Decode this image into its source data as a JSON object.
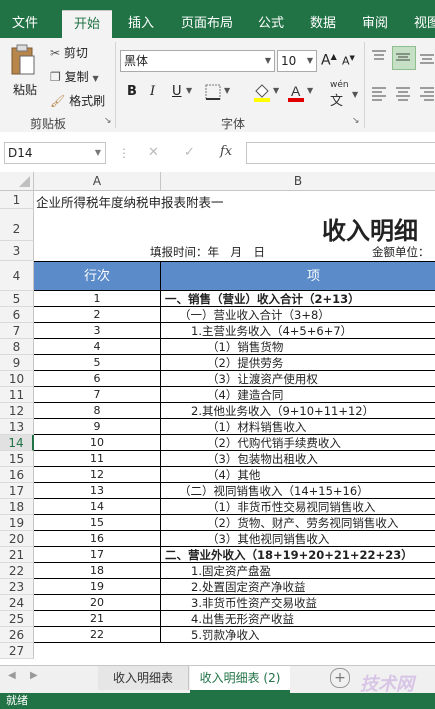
{
  "ribbon_tabs": [
    "文件",
    "开始",
    "插入",
    "页面布局",
    "公式",
    "数据",
    "审阅",
    "视图"
  ],
  "clipboard": {
    "paste": "粘贴",
    "cut": "剪切",
    "copy": "复制",
    "format_painter": "格式刷",
    "group": "剪贴板"
  },
  "font": {
    "name": "黑体",
    "size": "10",
    "group": "字体",
    "bold": "B",
    "italic": "I",
    "underline": "U",
    "grow": "A",
    "shrink": "A",
    "phonetic": "wén"
  },
  "name_box": "D14",
  "formula_buttons": {
    "cancel": "✕",
    "enter": "✓",
    "fx": "fx"
  },
  "columns": {
    "a": "A",
    "b": "B"
  },
  "rows": [
    {
      "n": "1",
      "a": "",
      "b": ""
    },
    {
      "n": "2",
      "a": "",
      "b": ""
    },
    {
      "n": "3",
      "a": "",
      "b": ""
    },
    {
      "n": "4",
      "a": "行次",
      "b": "项"
    },
    {
      "n": "5",
      "a": "1",
      "b": "一、销售（营业）收入合计（2+13）"
    },
    {
      "n": "6",
      "a": "2",
      "b": "（一）营业收入合计（3+8）"
    },
    {
      "n": "7",
      "a": "3",
      "b": "1.主营业务收入（4+5+6+7）"
    },
    {
      "n": "8",
      "a": "4",
      "b": "（1）销售货物"
    },
    {
      "n": "9",
      "a": "5",
      "b": "（2）提供劳务"
    },
    {
      "n": "10",
      "a": "6",
      "b": "（3）让渡资产使用权"
    },
    {
      "n": "11",
      "a": "7",
      "b": "（4）建造合同"
    },
    {
      "n": "12",
      "a": "8",
      "b": "2.其他业务收入（9+10+11+12）"
    },
    {
      "n": "13",
      "a": "9",
      "b": "（1）材料销售收入"
    },
    {
      "n": "14",
      "a": "10",
      "b": "（2）代购代销手续费收入"
    },
    {
      "n": "15",
      "a": "11",
      "b": "（3）包装物出租收入"
    },
    {
      "n": "16",
      "a": "12",
      "b": "（4）其他"
    },
    {
      "n": "17",
      "a": "13",
      "b": "（二）视同销售收入（14+15+16）"
    },
    {
      "n": "18",
      "a": "14",
      "b": "（1）非货币性交易视同销售收入"
    },
    {
      "n": "19",
      "a": "15",
      "b": "（2）货物、财产、劳务视同销售收入"
    },
    {
      "n": "20",
      "a": "16",
      "b": "（3）其他视同销售收入"
    },
    {
      "n": "21",
      "a": "17",
      "b": "二、营业外收入（18+19+20+21+22+23）"
    },
    {
      "n": "22",
      "a": "18",
      "b": "1.固定资产盘盈"
    },
    {
      "n": "23",
      "a": "19",
      "b": "2.处置固定资产净收益"
    },
    {
      "n": "24",
      "a": "20",
      "b": "3.非货币性资产交易收益"
    },
    {
      "n": "25",
      "a": "21",
      "b": "4.出售无形资产收益"
    },
    {
      "n": "26",
      "a": "22",
      "b": "5.罚款净收入"
    },
    {
      "n": "27",
      "a": "",
      "b": ""
    }
  ],
  "row1_title": "企业所得税年度纳税申报表附表一",
  "row2_title": "收入明细",
  "row3_left": "填报时间：年　月　日",
  "row3_right": "金额单位：",
  "sheets": [
    "收入明细表",
    "收入明细表 (2)"
  ],
  "status": "就绪",
  "watermark": "技术网"
}
